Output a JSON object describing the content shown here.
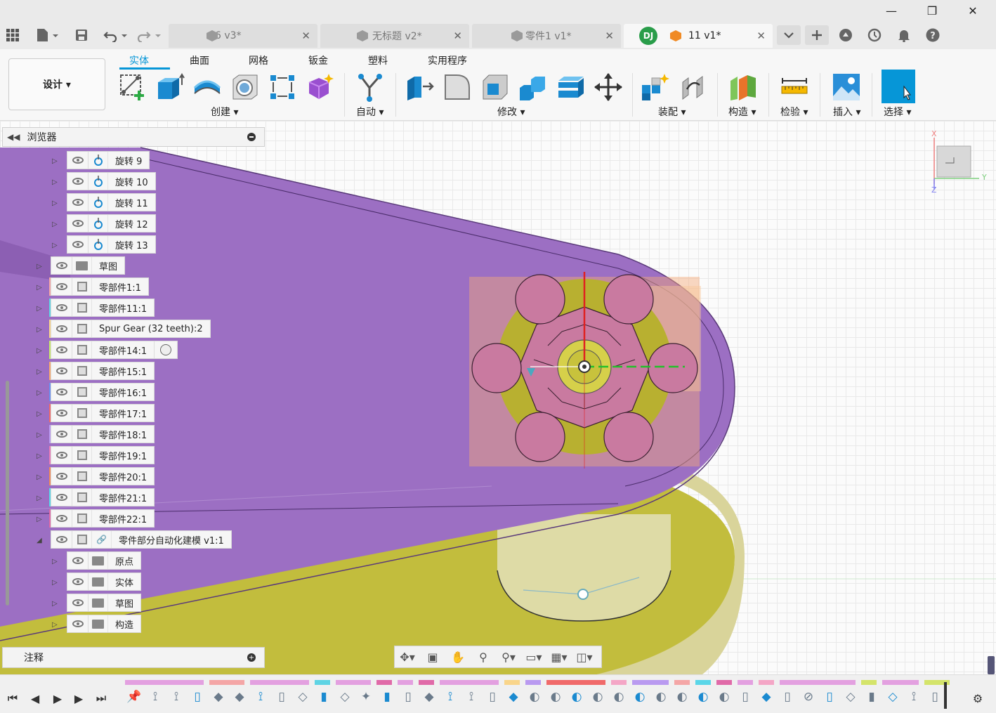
{
  "window": {
    "minimize": "—",
    "maximize": "❐",
    "close": "✕"
  },
  "tabs": [
    {
      "label": "6 v3*",
      "active": false
    },
    {
      "label": "无标题 v2*",
      "active": false
    },
    {
      "label": "零件1 v1*",
      "active": false
    },
    {
      "label": "11 v1*",
      "active": true
    }
  ],
  "tab_close": "✕",
  "avatar": "DJ",
  "toolbar": {
    "design": "设计 ▾",
    "workspace_tabs": [
      "实体",
      "曲面",
      "网格",
      "钣金",
      "塑料",
      "实用程序"
    ],
    "groups": [
      "创建 ▾",
      "自动 ▾",
      "修改 ▾",
      "装配 ▾",
      "构造 ▾",
      "检验 ▾",
      "插入 ▾",
      "选择 ▾"
    ]
  },
  "browser": {
    "title": "浏览器",
    "items": [
      {
        "label": "旋转 9",
        "color": ""
      },
      {
        "label": "旋转 10",
        "color": ""
      },
      {
        "label": "旋转 11",
        "color": ""
      },
      {
        "label": "旋转 12",
        "color": ""
      },
      {
        "label": "旋转 13",
        "color": ""
      },
      {
        "label": "草图",
        "color": ""
      },
      {
        "label": "零部件1:1",
        "color": "#f4a6a6"
      },
      {
        "label": "零部件11:1",
        "color": "#5fd4e4"
      },
      {
        "label": "Spur Gear (32 teeth):2",
        "color": "#f9d58a"
      },
      {
        "label": "零部件14:1",
        "color": "#c8e86a"
      },
      {
        "label": "零部件15:1",
        "color": "#f7a86e"
      },
      {
        "label": "零部件16:1",
        "color": "#6a8ff0"
      },
      {
        "label": "零部件17:1",
        "color": "#f06a6a"
      },
      {
        "label": "零部件18:1",
        "color": "#b99af0"
      },
      {
        "label": "零部件19:1",
        "color": "#e87ab8"
      },
      {
        "label": "零部件20:1",
        "color": "#f08a5a"
      },
      {
        "label": "零部件21:1",
        "color": "#5ad6e8"
      },
      {
        "label": "零部件22:1",
        "color": "#e06aa8"
      },
      {
        "label": "零件部分自动化建模 v1:1",
        "color": ""
      },
      {
        "label": "原点",
        "color": ""
      },
      {
        "label": "实体",
        "color": ""
      },
      {
        "label": "草图",
        "color": ""
      },
      {
        "label": "构造",
        "color": ""
      }
    ]
  },
  "notes": "注释",
  "viewcube": {
    "x": "X",
    "y": "Y",
    "z": "Z"
  },
  "colors": {
    "accent": "#0696d7",
    "plate": "#9a6dbf",
    "olive": "#b9b53a",
    "gear_part": "#c97aa0"
  }
}
